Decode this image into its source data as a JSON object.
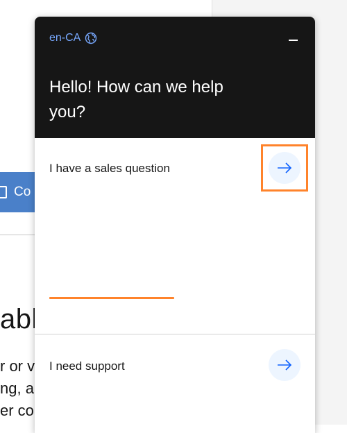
{
  "background": {
    "cta_label": "Co",
    "heading_fragment": "able",
    "paragraph_lines": [
      "r or v",
      "ng, a",
      "er co"
    ]
  },
  "chat": {
    "locale_label": "en-CA",
    "locale_icon": "globe-icon",
    "minimize_icon": "minimize-icon",
    "greeting": "Hello! How can we help you?",
    "options": [
      {
        "label": "I have a sales question",
        "icon": "arrow-right-icon"
      },
      {
        "label": "I need support",
        "icon": "arrow-right-icon"
      }
    ],
    "colors": {
      "header_bg": "#161616",
      "locale_text": "#78a9ff",
      "arrow": "#0f62fe",
      "arrow_bg": "#edf5ff",
      "highlight": "#ff832b",
      "page_cta_bg": "#4a80c9"
    }
  }
}
